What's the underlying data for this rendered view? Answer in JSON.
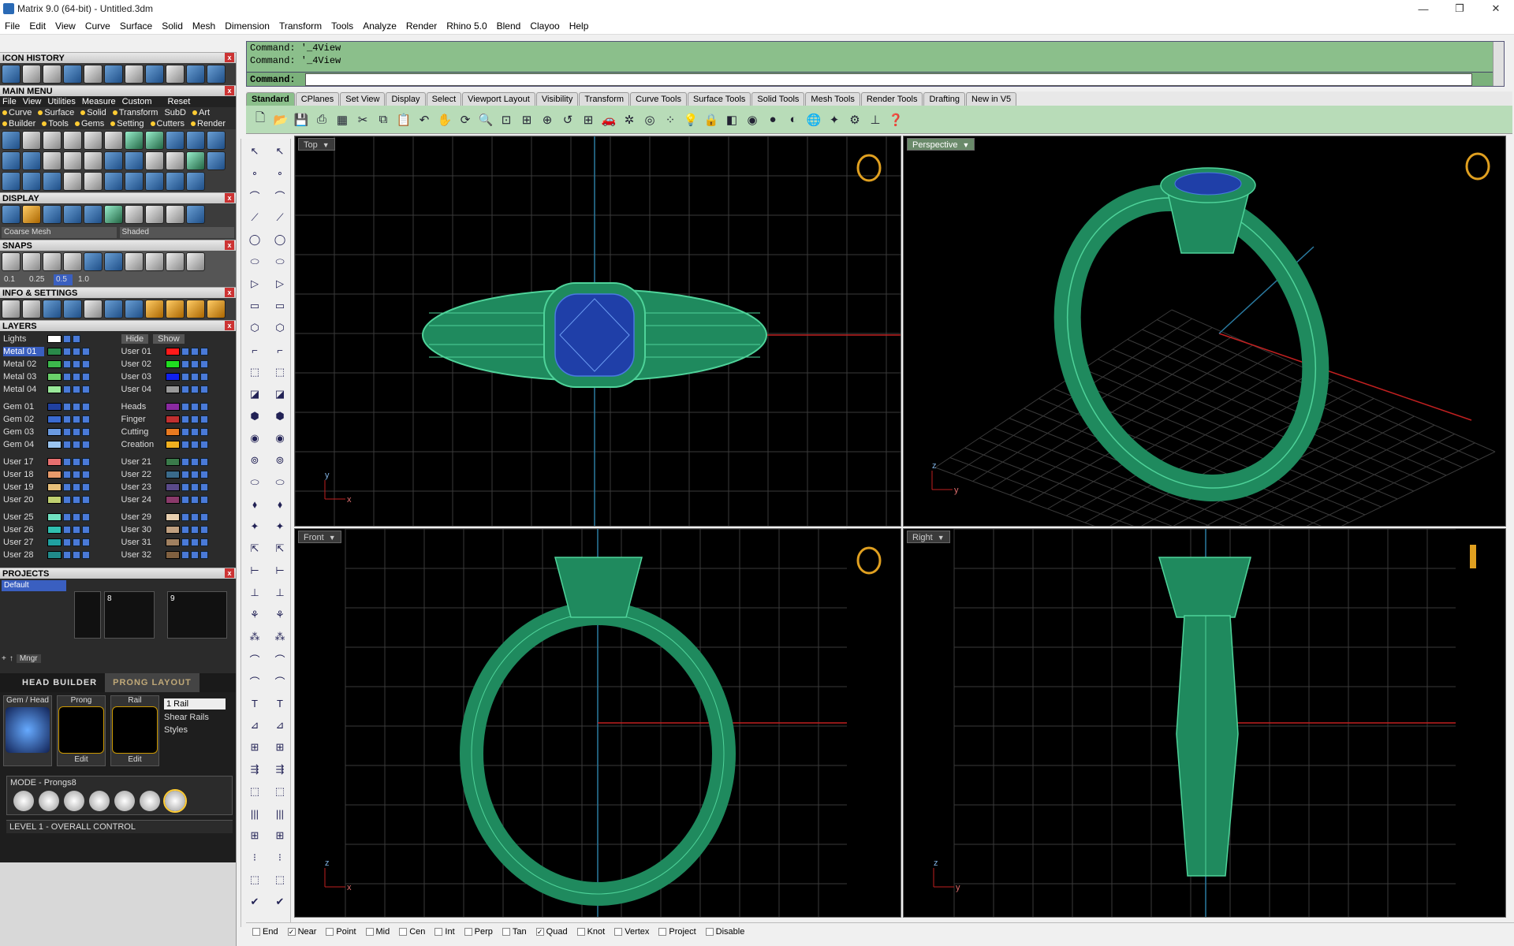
{
  "window": {
    "title": "Matrix 9.0 (64-bit) - Untitled.3dm",
    "minimize": "—",
    "restore": "❐",
    "close": "✕"
  },
  "menu": [
    "File",
    "Edit",
    "View",
    "Curve",
    "Surface",
    "Solid",
    "Mesh",
    "Dimension",
    "Transform",
    "Tools",
    "Analyze",
    "Render",
    "Rhino 5.0",
    "Blend",
    "Clayoo",
    "Help"
  ],
  "left": {
    "icon_history": "ICON HISTORY",
    "main_menu": "MAIN MENU",
    "main_menu_line1": [
      "File",
      "View",
      "Utilities",
      "Measure",
      "Custom",
      "Reset"
    ],
    "main_menu_line2": [
      "Curve",
      "Surface",
      "Solid",
      "Transform",
      "SubD",
      "Art"
    ],
    "main_menu_line3": [
      "Builder",
      "Tools",
      "Gems",
      "Setting",
      "Cutters",
      "Render"
    ],
    "display": "DISPLAY",
    "display_mesh": "Coarse Mesh",
    "display_mode": "Shaded",
    "snaps": "SNAPS",
    "snap_values": [
      "0.1",
      "0.25",
      "0.5",
      "1.0"
    ],
    "info_settings": "INFO & SETTINGS",
    "layers_title": "LAYERS",
    "lights_label": "Lights",
    "hide_label": "Hide",
    "show_label": "Show",
    "layer_groups": [
      [
        [
          "Metal 01",
          "#2a8a4a",
          "User 01",
          "#ff1a1a"
        ],
        [
          "Metal 02",
          "#3cb84c",
          "User 02",
          "#20dd20"
        ],
        [
          "Metal 03",
          "#6ad06a",
          "User 03",
          "#1020ee"
        ],
        [
          "Metal 04",
          "#9ae89a",
          "User 04",
          "#999999"
        ]
      ],
      [
        [
          "Gem 01",
          "#2040a0",
          "Heads",
          "#8a2aa0"
        ],
        [
          "Gem 02",
          "#3a6ad0",
          "Finger",
          "#c03030"
        ],
        [
          "Gem 03",
          "#6a9ae0",
          "Cutting",
          "#e87a20"
        ],
        [
          "Gem 04",
          "#9ac4f0",
          "Creation",
          "#f0b020"
        ]
      ],
      [
        [
          "User 17",
          "#e87070",
          "User 21",
          "#3a7a4a"
        ],
        [
          "User 18",
          "#e89a6a",
          "User 22",
          "#3a6a8a"
        ],
        [
          "User 19",
          "#e8c07a",
          "User 23",
          "#5a4a8a"
        ],
        [
          "User 20",
          "#c0d070",
          "User 24",
          "#8a3a6a"
        ]
      ],
      [
        [
          "User 25",
          "#70e0c0",
          "User 29",
          "#e8d0b0"
        ],
        [
          "User 26",
          "#30c0b0",
          "User 30",
          "#c0a080"
        ],
        [
          "User 27",
          "#20a0a0",
          "User 31",
          "#a08060"
        ],
        [
          "User 28",
          "#208a8a",
          "User 32",
          "#806040"
        ]
      ]
    ],
    "projects_title": "PROJECTS",
    "project_default": "Default",
    "project_thumb_nums": [
      "8",
      "9"
    ],
    "mngr": "Mngr",
    "head_builder": "HEAD  BUILDER",
    "prong_layout": "PRONG LAYOUT",
    "card_gem": "Gem / Head",
    "card_prong": "Prong",
    "card_rail": "Rail",
    "edit1": "Edit",
    "edit2": "Edit",
    "rail_select": "1 Rail",
    "shear_rails": "Shear Rails",
    "styles": "Styles",
    "mode": "MODE - Prongs8",
    "level": "LEVEL 1 - OVERALL CONTROL"
  },
  "command": {
    "line1": "Command: '_4View",
    "line2": "Command: '_4View",
    "prompt": "Command:",
    "value": ""
  },
  "tabs": [
    "Standard",
    "CPlanes",
    "Set View",
    "Display",
    "Select",
    "Viewport Layout",
    "Visibility",
    "Transform",
    "Curve Tools",
    "Surface Tools",
    "Solid Tools",
    "Mesh Tools",
    "Render Tools",
    "Drafting",
    "New in V5"
  ],
  "viewports": {
    "top": "Top",
    "perspective": "Perspective",
    "front": "Front",
    "right": "Right",
    "axis_x": "x",
    "axis_y": "y",
    "axis_z": "z"
  },
  "snaps_bar": [
    {
      "label": "End",
      "checked": false
    },
    {
      "label": "Near",
      "checked": true
    },
    {
      "label": "Point",
      "checked": false
    },
    {
      "label": "Mid",
      "checked": false
    },
    {
      "label": "Cen",
      "checked": false
    },
    {
      "label": "Int",
      "checked": false
    },
    {
      "label": "Perp",
      "checked": false
    },
    {
      "label": "Tan",
      "checked": false
    },
    {
      "label": "Quad",
      "checked": true
    },
    {
      "label": "Knot",
      "checked": false
    },
    {
      "label": "Vertex",
      "checked": false
    },
    {
      "label": "Project",
      "checked": false
    },
    {
      "label": "Disable",
      "checked": false
    }
  ],
  "colors": {
    "ring": "#1f8a5e",
    "ring_wire": "#4fd39a",
    "gem": "#1f3fa8",
    "grid": "#3a3a3a",
    "axis_red": "#c02020",
    "axis_blue": "#2a7aa0",
    "cmd_bg": "#8bbf8b"
  }
}
